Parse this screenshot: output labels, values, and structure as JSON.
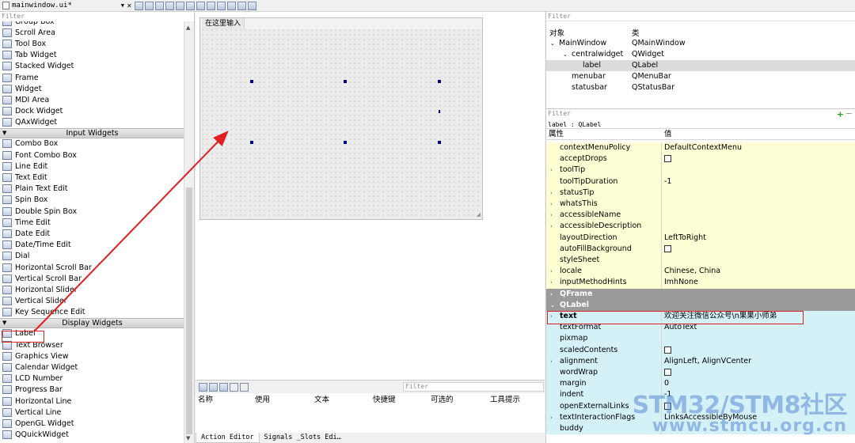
{
  "file_tab": {
    "name": "mainwindow.ui*"
  },
  "widget_box": {
    "filter_placeholder": "Filter",
    "items_top": [
      {
        "label": "Group Box",
        "icon": "group-box-icon"
      },
      {
        "label": "Scroll Area",
        "icon": "scroll-area-icon"
      },
      {
        "label": "Tool Box",
        "icon": "tool-box-icon"
      },
      {
        "label": "Tab Widget",
        "icon": "tab-widget-icon"
      },
      {
        "label": "Stacked Widget",
        "icon": "stacked-widget-icon"
      },
      {
        "label": "Frame",
        "icon": "frame-icon"
      },
      {
        "label": "Widget",
        "icon": "widget-icon"
      },
      {
        "label": "MDI Area",
        "icon": "mdi-area-icon"
      },
      {
        "label": "Dock Widget",
        "icon": "dock-widget-icon"
      },
      {
        "label": "QAxWidget",
        "icon": "qaxwidget-icon"
      }
    ],
    "category_input": "Input Widgets",
    "items_input": [
      {
        "label": "Combo Box",
        "icon": "combo-box-icon"
      },
      {
        "label": "Font Combo Box",
        "icon": "font-combo-box-icon"
      },
      {
        "label": "Line Edit",
        "icon": "line-edit-icon"
      },
      {
        "label": "Text Edit",
        "icon": "text-edit-icon"
      },
      {
        "label": "Plain Text Edit",
        "icon": "plain-text-edit-icon"
      },
      {
        "label": "Spin Box",
        "icon": "spin-box-icon"
      },
      {
        "label": "Double Spin Box",
        "icon": "double-spin-box-icon"
      },
      {
        "label": "Time Edit",
        "icon": "time-edit-icon"
      },
      {
        "label": "Date Edit",
        "icon": "date-edit-icon"
      },
      {
        "label": "Date/Time Edit",
        "icon": "date-time-edit-icon"
      },
      {
        "label": "Dial",
        "icon": "dial-icon"
      },
      {
        "label": "Horizontal Scroll Bar",
        "icon": "horizontal-scroll-bar-icon"
      },
      {
        "label": "Vertical Scroll Bar",
        "icon": "vertical-scroll-bar-icon"
      },
      {
        "label": "Horizontal Slider",
        "icon": "horizontal-slider-icon"
      },
      {
        "label": "Vertical Slider",
        "icon": "vertical-slider-icon"
      },
      {
        "label": "Key Sequence Edit",
        "icon": "key-sequence-edit-icon"
      }
    ],
    "category_display": "Display Widgets",
    "items_display": [
      {
        "label": "Label",
        "icon": "label-icon"
      },
      {
        "label": "Text Browser",
        "icon": "text-browser-icon"
      },
      {
        "label": "Graphics View",
        "icon": "graphics-view-icon"
      },
      {
        "label": "Calendar Widget",
        "icon": "calendar-widget-icon"
      },
      {
        "label": "LCD Number",
        "icon": "lcd-number-icon"
      },
      {
        "label": "Progress Bar",
        "icon": "progress-bar-icon"
      },
      {
        "label": "Horizontal Line",
        "icon": "horizontal-line-icon"
      },
      {
        "label": "Vertical Line",
        "icon": "vertical-line-icon"
      },
      {
        "label": "OpenGL Widget",
        "icon": "opengl-widget-icon"
      },
      {
        "label": "QQuickWidget",
        "icon": "qquickwidget-icon"
      }
    ]
  },
  "form": {
    "menu_placeholder": "在这里输入"
  },
  "action_editor": {
    "filter_placeholder": "Filter",
    "columns": [
      "名称",
      "使用",
      "文本",
      "快捷键",
      "可选的",
      "工具提示"
    ],
    "tabs": [
      "Action Editor",
      "Signals _Slots Edi…"
    ]
  },
  "object_inspector": {
    "filter_placeholder": "Filter",
    "col_object": "对象",
    "col_class": "类",
    "rows": [
      {
        "object": "MainWindow",
        "class": "QMainWindow"
      },
      {
        "object": "centralwidget",
        "class": "QWidget"
      },
      {
        "object": "label",
        "class": "QLabel"
      },
      {
        "object": "menubar",
        "class": "QMenuBar"
      },
      {
        "object": "statusbar",
        "class": "QStatusBar"
      }
    ]
  },
  "property_editor": {
    "filter_placeholder": "Filter",
    "object_label": "label : QLabel",
    "col_property": "属性",
    "col_value": "值",
    "rows": [
      {
        "name": "contextMenuPolicy",
        "value": "DefaultContextMenu"
      },
      {
        "name": "acceptDrops",
        "value": ""
      },
      {
        "name": "toolTip",
        "value": ""
      },
      {
        "name": "toolTipDuration",
        "value": "-1"
      },
      {
        "name": "statusTip",
        "value": ""
      },
      {
        "name": "whatsThis",
        "value": ""
      },
      {
        "name": "accessibleName",
        "value": ""
      },
      {
        "name": "accessibleDescription",
        "value": ""
      },
      {
        "name": "layoutDirection",
        "value": "LeftToRight"
      },
      {
        "name": "autoFillBackground",
        "value": ""
      },
      {
        "name": "styleSheet",
        "value": ""
      },
      {
        "name": "locale",
        "value": "Chinese, China"
      },
      {
        "name": "inputMethodHints",
        "value": "ImhNone"
      },
      {
        "name": "QFrame",
        "value": ""
      },
      {
        "name": "QLabel",
        "value": ""
      },
      {
        "name": "text",
        "value": "欢迎关注微信公众号\\n果果小师弟"
      },
      {
        "name": "textFormat",
        "value": "AutoText"
      },
      {
        "name": "pixmap",
        "value": ""
      },
      {
        "name": "scaledContents",
        "value": ""
      },
      {
        "name": "alignment",
        "value": "AlignLeft, AlignVCenter"
      },
      {
        "name": "wordWrap",
        "value": ""
      },
      {
        "name": "margin",
        "value": "0"
      },
      {
        "name": "indent",
        "value": "-1"
      },
      {
        "name": "openExternalLinks",
        "value": ""
      },
      {
        "name": "textInteractionFlags",
        "value": "LinksAccessibleByMouse"
      },
      {
        "name": "buddy",
        "value": ""
      }
    ]
  },
  "watermark": {
    "line1": "STM32/STM8社区",
    "line2": "www.stmcu.org.cn"
  },
  "colors": {
    "highlight_red": "#e02020",
    "property_yellow": "#ffffd6",
    "property_cyan": "#d4f1f7",
    "group_gray": "#9a9a9a"
  }
}
